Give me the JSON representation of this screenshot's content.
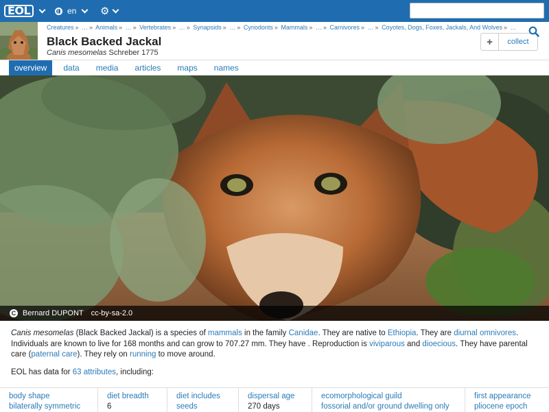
{
  "topbar": {
    "logo": "EOL",
    "language": "en",
    "search_placeholder": ""
  },
  "header": {
    "breadcrumb": [
      "Creatures",
      "…",
      "Animals",
      "…",
      "Vertebrates",
      "…",
      "Synapsids",
      "…",
      "Cynodonts",
      "Mammals",
      "…",
      "Carnivores",
      "…",
      "Coyotes, Dogs, Foxes, Jackals, And Wolves",
      "…"
    ],
    "title": "Black Backed Jackal",
    "sci_name": "Canis mesomelas",
    "authority": "Schreber 1775",
    "collect_label": "collect"
  },
  "tabs": [
    {
      "label": "overview",
      "active": true
    },
    {
      "label": "data",
      "active": false
    },
    {
      "label": "media",
      "active": false
    },
    {
      "label": "articles",
      "active": false
    },
    {
      "label": "maps",
      "active": false
    },
    {
      "label": "names",
      "active": false
    }
  ],
  "image_caption": {
    "license_icon": "C",
    "author": "Bernard DUPONT",
    "license": "cc-by-sa-2.0"
  },
  "description": {
    "s1": "Canis mesomelas",
    "s2": " (Black Backed Jackal) is a species of ",
    "l1": "mammals",
    "s3": " in the family ",
    "l2": "Canidae",
    "s4": ". They are native to ",
    "l3": "Ethiopia",
    "s5": ". They are ",
    "l4": "diurnal",
    "s6": " ",
    "l5": "omnivores",
    "s7": ". Individuals are known to live for 168 months and can grow to 707.27 mm. They have . Reproduction is ",
    "l6": "viviparous",
    "s8": " and ",
    "l7": "dioecious",
    "s9": ". They have parental care (",
    "l8": "paternal care",
    "s10": "). They rely on ",
    "l9": "running",
    "s11": " to move around."
  },
  "attributes_line": {
    "prefix": "EOL has data for ",
    "link": "63 attributes",
    "suffix": ", including:"
  },
  "attributes": [
    {
      "name": "body shape",
      "value": "bilaterally symmetric",
      "value_link": true
    },
    {
      "name": "diet breadth",
      "value": "6",
      "value_link": false
    },
    {
      "name": "diet includes",
      "value": "seeds",
      "value_link": true
    },
    {
      "name": "dispersal age",
      "value": "270 days",
      "value_link": false
    },
    {
      "name": "ecomorphological guild",
      "value": "fossorial and/or ground dwelling only",
      "value_link": true
    },
    {
      "name": "first appearance",
      "value": "pliocene epoch",
      "value_link": true
    }
  ]
}
